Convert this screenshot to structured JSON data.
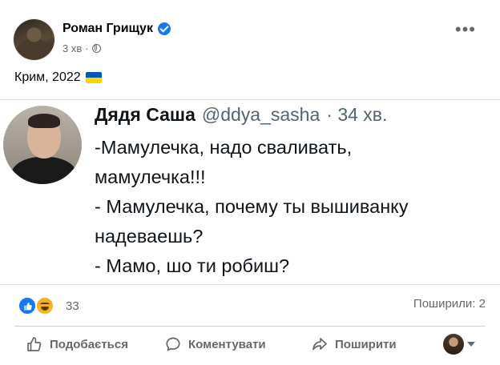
{
  "post": {
    "author": "Роман Грищук",
    "time": "3 хв",
    "separator": "·",
    "text": "Крим, 2022",
    "more_label": "•••"
  },
  "tweet": {
    "name": "Дядя Саша",
    "handle": "@ddya_sasha",
    "time": "· 34 хв.",
    "lines": [
      "-Мамулечка, надо сваливать,",
      "мамулечка!!!",
      "- Мамулечка, почему ты вышиванку",
      "надеваешь?",
      "- Мамо, шо ти робиш?"
    ]
  },
  "stats": {
    "reactions_count": "33",
    "shares": "Поширили: 2"
  },
  "actions": {
    "like": "Подобається",
    "comment": "Коментувати",
    "share": "Поширити"
  },
  "colors": {
    "accent": "#1877f2",
    "secondary_text": "#65676b",
    "flag_blue": "#0057b7",
    "flag_yellow": "#ffd700"
  },
  "icons": [
    "verified-badge-icon",
    "globe-icon",
    "more-options-icon",
    "ukraine-flag-icon",
    "like-reaction-icon",
    "haha-reaction-icon",
    "thumbs-up-icon",
    "comment-icon",
    "share-icon",
    "chevron-down-icon"
  ]
}
